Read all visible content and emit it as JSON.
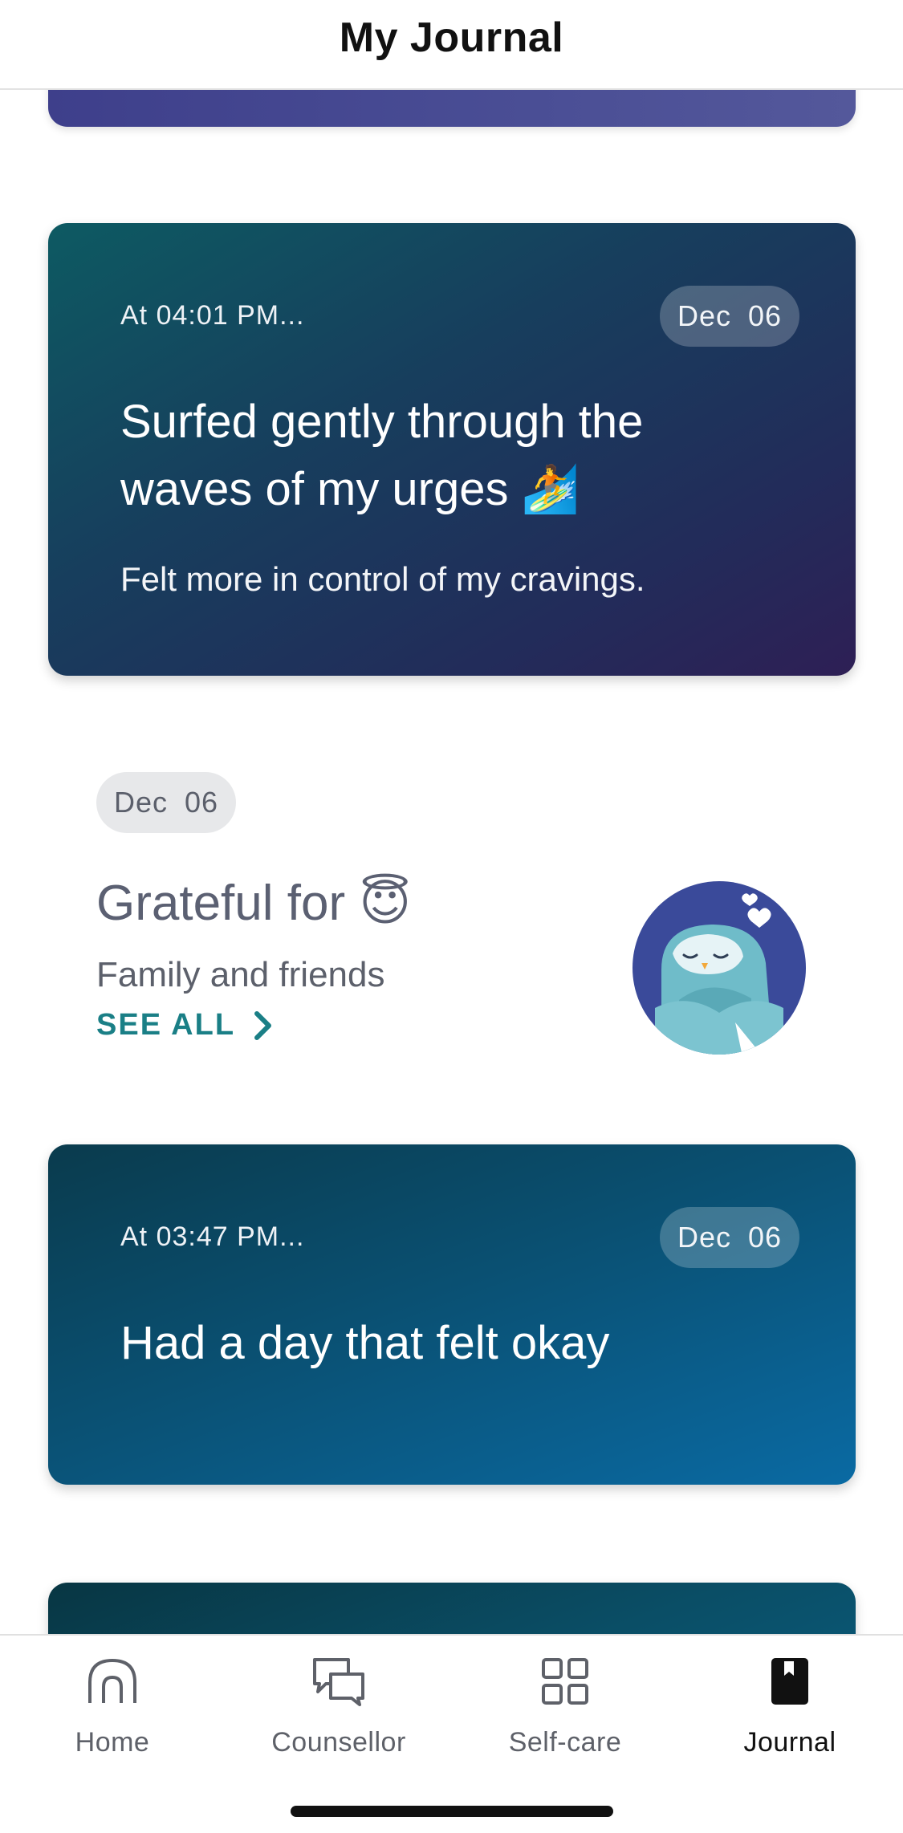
{
  "header": {
    "title": "My Journal"
  },
  "entries": [
    {
      "time": "At 04:01 PM...",
      "date": "Dec 06",
      "title": "Surfed gently through the waves of my urges 🏄",
      "body": "Felt more in control of my cravings."
    },
    {
      "time": "At 03:47 PM...",
      "date": "Dec 06",
      "title": "Had a day that felt okay",
      "body": ""
    }
  ],
  "gratitude": {
    "date": "Dec 06",
    "title": "Grateful for 😇",
    "body": "Family and friends",
    "see_all": "SEE ALL"
  },
  "tabs": [
    {
      "label": "Home",
      "icon": "home-icon",
      "active": false
    },
    {
      "label": "Counsellor",
      "icon": "chat-bubbles-icon",
      "active": false
    },
    {
      "label": "Self-care",
      "icon": "grid-icon",
      "active": false
    },
    {
      "label": "Journal",
      "icon": "journal-bookmark-icon",
      "active": true
    }
  ],
  "colors": {
    "accent": "#1a7f86",
    "card_purple": "#2e1f55",
    "card_blue": "#0a6aa3",
    "owl_circle": "#3a4a9a"
  }
}
